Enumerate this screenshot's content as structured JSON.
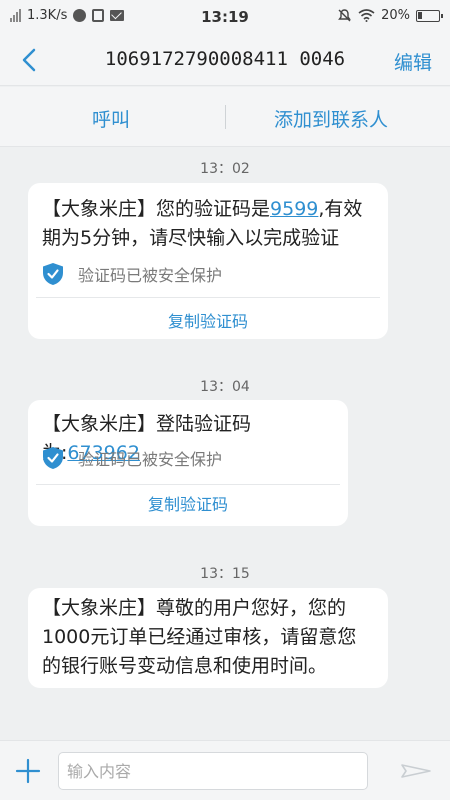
{
  "status_bar": {
    "net_speed": "1.3K/s",
    "time": "13:19",
    "battery": "20%"
  },
  "title_bar": {
    "title": "1069172790008411 0046",
    "edit_label": "编辑"
  },
  "actions": {
    "call_label": "呼叫",
    "add_contact_label": "添加到联系人"
  },
  "messages": [
    {
      "time": "13：02",
      "prefix": "【大象米庄】您的验证码是",
      "code": "9599",
      "suffix": ",有效期为5分钟，请尽快输入以完成验证",
      "safe_text": "验证码已被安全保护",
      "copy_label": "复制验证码"
    },
    {
      "time": "13：04",
      "prefix": "【大象米庄】登陆验证码为:",
      "code": "673962",
      "safe_text": "验证码已被安全保护",
      "copy_label": "复制验证码"
    },
    {
      "time": "13：15",
      "text": "【大象米庄】尊敬的用户您好，您的1000元订单已经通过审核，请留意您的银行账号变动信息和使用时间。"
    }
  ],
  "input_bar": {
    "placeholder": "输入内容"
  },
  "colors": {
    "accent": "#2f8fd0",
    "background": "#eef0f1",
    "bubble": "#ffffff"
  }
}
